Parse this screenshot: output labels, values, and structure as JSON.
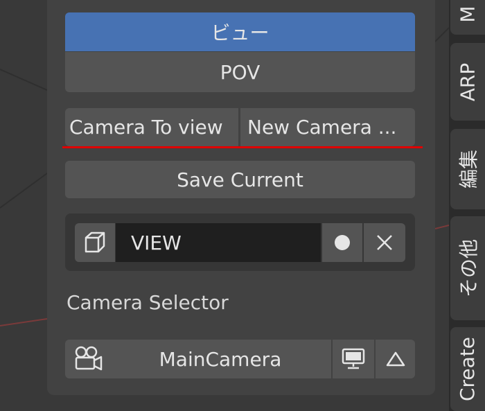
{
  "mode_toggle": {
    "active_label": "ビュー",
    "inactive_label": "POV"
  },
  "camera_actions": {
    "to_view_label": "Camera To view",
    "new_camera_label": "New Camera ..."
  },
  "save_current_label": "Save Current",
  "view_slot": {
    "name_value": "VIEW",
    "icon": "cube-icon",
    "toggle_icon": "dot-icon",
    "clear_icon": "close-icon"
  },
  "camera_selector": {
    "label": "Camera Selector",
    "selected_camera": "MainCamera",
    "icons": [
      "camera-icon",
      "monitor-icon",
      "triangle-up-icon"
    ]
  },
  "side_tabs": [
    "M",
    "ARP",
    "編集",
    "その他",
    "Create"
  ],
  "colors": {
    "accent": "#4772b3",
    "annotation_line": "#e00000"
  }
}
